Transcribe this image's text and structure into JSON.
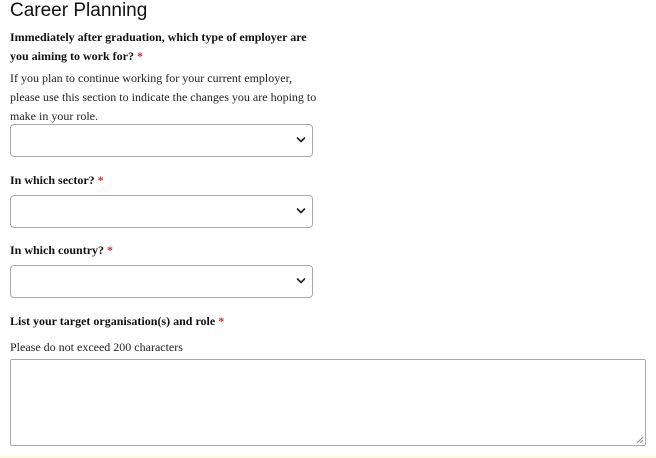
{
  "page": {
    "title": "Career Planning"
  },
  "questions": [
    {
      "label": "Immediately after graduation, which type of employer are you aiming to work for?",
      "required_mark": "*",
      "help": "If you plan to continue working for your current employer, please use this section to indicate the changes you are hoping to make in your role.",
      "value": ""
    },
    {
      "label": "In which sector?",
      "required_mark": "*",
      "value": ""
    },
    {
      "label": "In which country?",
      "required_mark": "*",
      "value": ""
    },
    {
      "label": "List your target organisation(s) and role",
      "required_mark": "*",
      "help": "Please do not exceed 200 characters",
      "value": ""
    }
  ],
  "icons": {
    "dropdown": "chevron-down-icon",
    "resize": "resize-grip-icon"
  },
  "colors": {
    "required": "#d0312d",
    "border": "#a9a9a9",
    "text": "#111111"
  }
}
